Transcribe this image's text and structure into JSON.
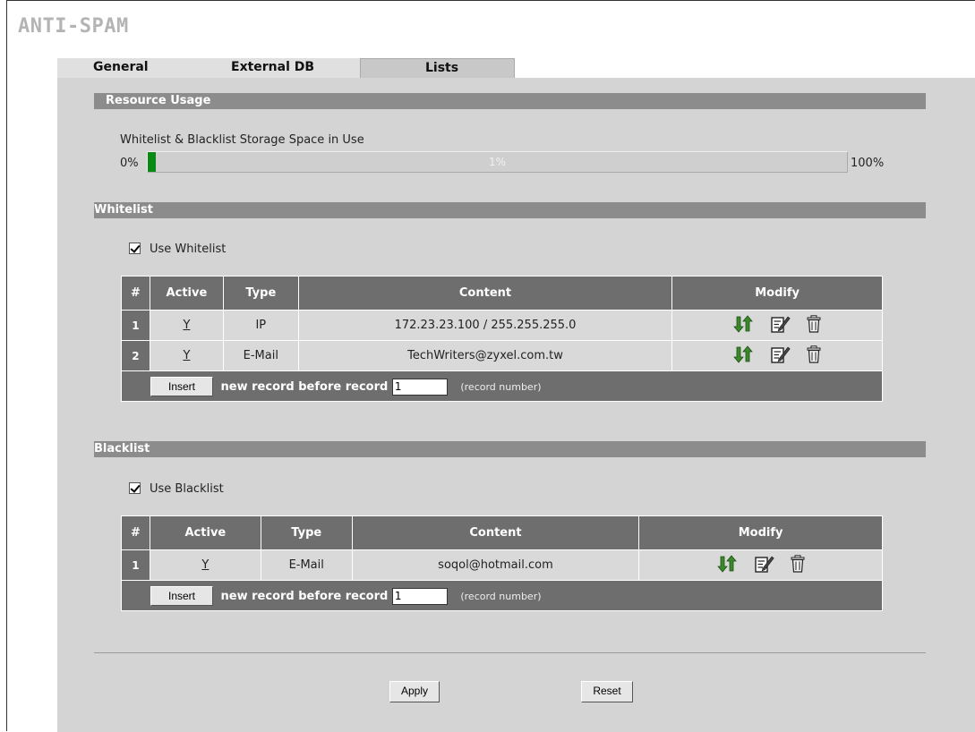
{
  "page_title": "ANTI-SPAM",
  "tabs": [
    {
      "label": "General"
    },
    {
      "label": "External DB"
    },
    {
      "label": "Lists"
    }
  ],
  "resource_usage": {
    "heading": "Resource Usage",
    "storage_label": "Whitelist & Blacklist Storage Space in Use",
    "min_label": "0%",
    "max_label": "100%",
    "usage_text": "1%",
    "usage_fraction": 0.01,
    "fill_color": "#0a8a14"
  },
  "whitelist": {
    "heading": "Whitelist",
    "use_label": "Use Whitelist",
    "use_checked": true,
    "columns": [
      "#",
      "Active",
      "Type",
      "Content",
      "Modify"
    ],
    "rows": [
      {
        "num": "1",
        "active": "Y",
        "type": "IP",
        "content": "172.23.23.100 / 255.255.255.0"
      },
      {
        "num": "2",
        "active": "Y",
        "type": "E-Mail",
        "content": "TechWriters@zyxel.com.tw"
      }
    ],
    "insert_label": "Insert",
    "insert_text": "new record before record",
    "record_value": "1",
    "record_hint": "(record number)"
  },
  "blacklist": {
    "heading": "Blacklist",
    "use_label": "Use Blacklist",
    "use_checked": true,
    "columns": [
      "#",
      "Active",
      "Type",
      "Content",
      "Modify"
    ],
    "rows": [
      {
        "num": "1",
        "active": "Y",
        "type": "E-Mail",
        "content": "soqol@hotmail.com"
      }
    ],
    "insert_label": "Insert",
    "insert_text": "new record before record",
    "record_value": "1",
    "record_hint": "(record number)"
  },
  "actions": {
    "apply_label": "Apply",
    "reset_label": "Reset"
  },
  "icons": {
    "move": "move-arrows-icon",
    "edit": "edit-icon",
    "delete": "trash-icon"
  }
}
